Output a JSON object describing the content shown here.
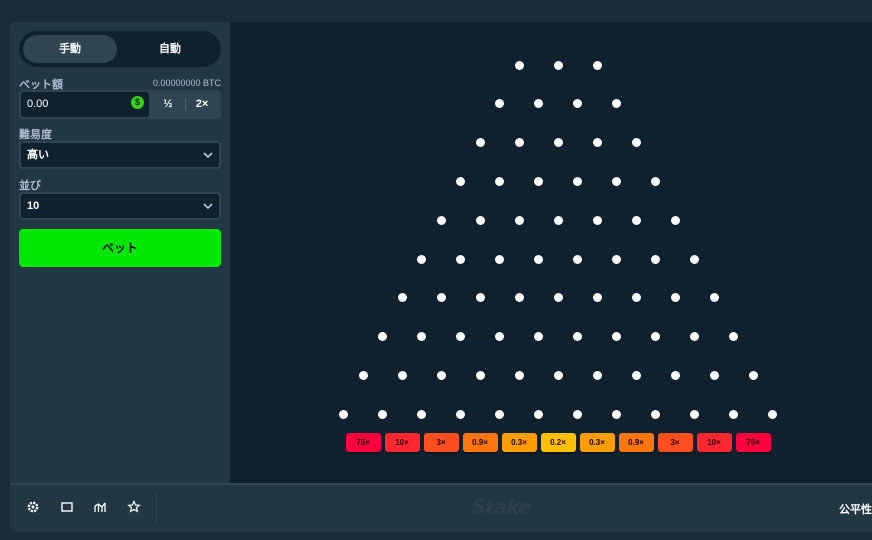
{
  "mode_toggle": {
    "manual": "手動",
    "auto": "自動",
    "active": "manual"
  },
  "bet": {
    "label": "ベット額",
    "balance": "0.00000000 BTC",
    "value": "0.00",
    "currency_icon": "dollar-coin-icon",
    "half": "½",
    "double": "2×"
  },
  "difficulty": {
    "label": "難易度",
    "selected": "高い"
  },
  "rows": {
    "label": "並び",
    "selected": "10"
  },
  "bet_button": "ベット",
  "board": {
    "rows": 10,
    "multipliers": [
      "76×",
      "10×",
      "3×",
      "0.9×",
      "0.3×",
      "0.2×",
      "0.3×",
      "0.9×",
      "3×",
      "10×",
      "76×"
    ],
    "slot_colors": [
      "#ff003f",
      "#ff2730",
      "#ff4e20",
      "#ff7610",
      "#ff9d01",
      "#ffc000",
      "#ff9d01",
      "#ff7610",
      "#ff4e20",
      "#ff2730",
      "#ff003f"
    ]
  },
  "footer": {
    "icons": [
      "settings-icon",
      "theatre-mode-icon",
      "live-stats-icon",
      "favourite-star-icon"
    ],
    "logo": "Stake",
    "fairness": "公平性"
  },
  "colors": {
    "accent": "#00e701",
    "panel": "#213743",
    "board": "#0f212e"
  }
}
